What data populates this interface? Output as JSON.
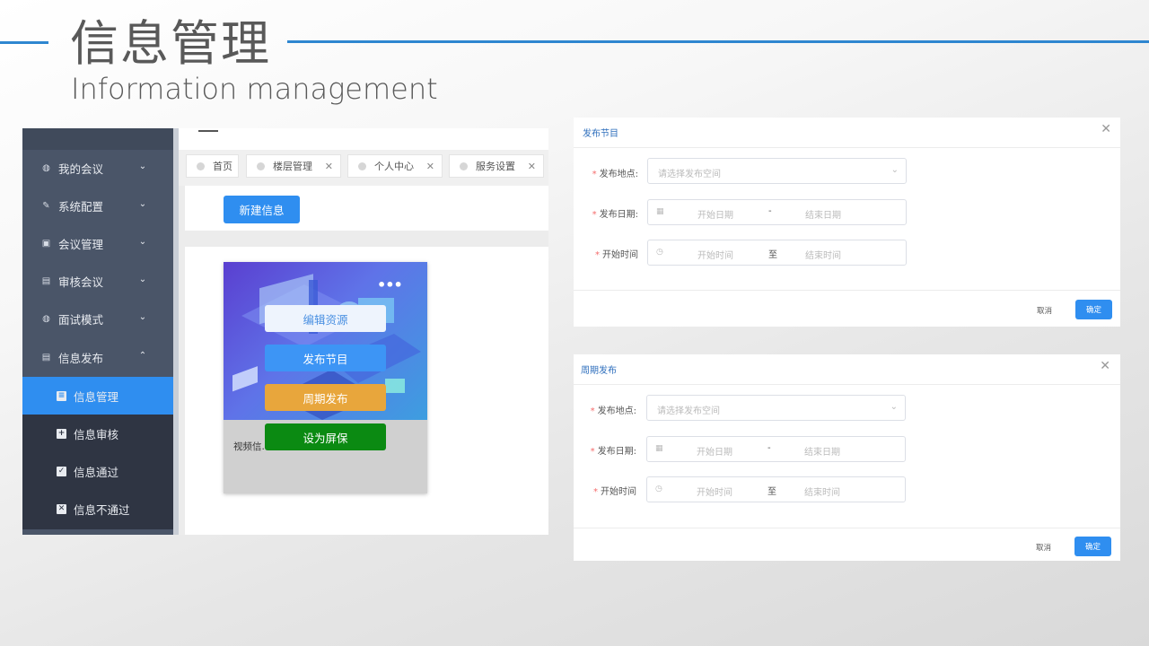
{
  "slide": {
    "title": "信息管理",
    "subtitle": "Information management",
    "accent_color": "#2e86d0"
  },
  "sidebar": {
    "items": [
      {
        "label": "我的会议",
        "icon": "globe-icon",
        "expanded": false
      },
      {
        "label": "系统配置",
        "icon": "wrench-icon",
        "expanded": false
      },
      {
        "label": "会议管理",
        "icon": "calendar-box-icon",
        "expanded": false
      },
      {
        "label": "审核会议",
        "icon": "edit-box-icon",
        "expanded": false
      },
      {
        "label": "面试模式",
        "icon": "globe-icon",
        "expanded": false
      },
      {
        "label": "信息发布",
        "icon": "document-icon",
        "expanded": true
      }
    ],
    "sub_items": [
      {
        "label": "信息管理",
        "icon": "list-icon",
        "active": true
      },
      {
        "label": "信息审核",
        "icon": "plus-box-icon",
        "active": false
      },
      {
        "label": "信息通过",
        "icon": "check-box-icon",
        "active": false
      },
      {
        "label": "信息不通过",
        "icon": "cross-box-icon",
        "active": false
      }
    ]
  },
  "tabs": [
    {
      "label": "首页",
      "closable": false
    },
    {
      "label": "楼层管理",
      "closable": true
    },
    {
      "label": "个人中心",
      "closable": true
    },
    {
      "label": "服务设置",
      "closable": true
    }
  ],
  "main": {
    "new_button": "新建信息",
    "card": {
      "caption": "视频信...",
      "more_icon": "more-dots-icon",
      "buttons": [
        {
          "label": "编辑资源",
          "bg": "#eef4fd",
          "color": "#4a90e2"
        },
        {
          "label": "发布节目",
          "bg": "#3d95f5",
          "color": "#ffffff"
        },
        {
          "label": "周期发布",
          "bg": "#e8a63c",
          "color": "#ffffff"
        },
        {
          "label": "设为屏保",
          "bg": "#0b8a12",
          "color": "#ffffff"
        }
      ]
    }
  },
  "dialogs": [
    {
      "title": "发布节目",
      "fields": {
        "location_label": "发布地点:",
        "location_placeholder": "请选择发布空间",
        "date_label": "发布日期:",
        "date_start": "开始日期",
        "date_sep": "-",
        "date_end": "结束日期",
        "time_label": "开始时间",
        "time_start": "开始时间",
        "time_sep": "至",
        "time_end": "结束时间"
      },
      "cancel": "取消",
      "ok": "确定"
    },
    {
      "title": "周期发布",
      "fields": {
        "location_label": "发布地点:",
        "location_placeholder": "请选择发布空间",
        "date_label": "发布日期:",
        "date_start": "开始日期",
        "date_sep": "-",
        "date_end": "结束日期",
        "time_label": "开始时间",
        "time_start": "开始时间",
        "time_sep": "至",
        "time_end": "结束时间"
      },
      "cancel": "取消",
      "ok": "确定"
    }
  ]
}
